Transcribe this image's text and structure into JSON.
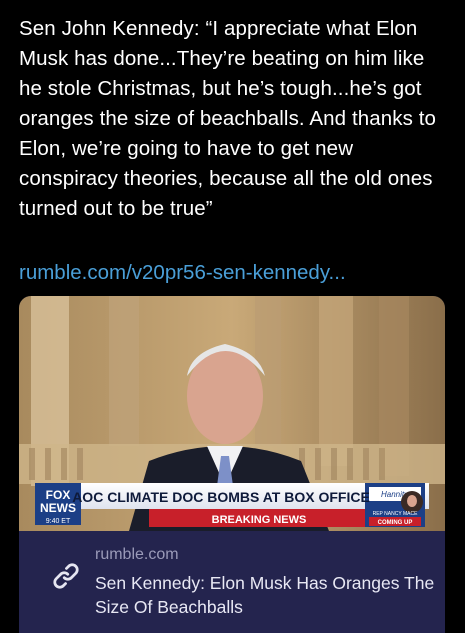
{
  "post": {
    "text": "Sen John Kennedy: “I appreciate what Elon Musk has done...They’re beating on him like he stole Christmas, but he’s tough...he’s got oranges the size of beachballs. And thanks to Elon, we’re going to have to get new conspiracy theories, because all the old ones turned out to be true”",
    "link_text": "rumble.com/v20pr56-sen-kennedy..."
  },
  "card": {
    "domain": "rumble.com",
    "title": "Sen Kennedy: Elon Musk Has Oranges The Size Of Beachballs",
    "icon": "link-icon"
  },
  "broadcast": {
    "logo_line1": "FOX",
    "logo_line2": "NEWS",
    "time": "9:40 ET",
    "headline": "AOC CLIMATE DOC BOMBS AT BOX OFFICE",
    "breaking_label": "BREAKING NEWS",
    "show_name": "Hannity",
    "guest_label": "REP NANCY MACE",
    "coming_up": "COMING UP"
  },
  "colors": {
    "link": "#4a9fd8",
    "card_bg": "#24244e",
    "breaking_red": "#c8202a"
  }
}
